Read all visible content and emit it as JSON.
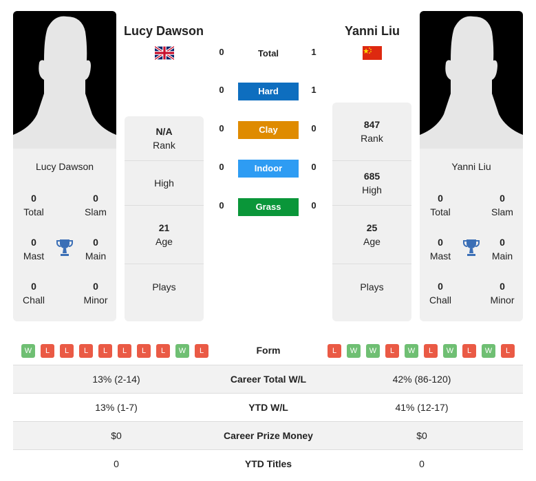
{
  "colors": {
    "hard": "#0e6ebf",
    "clay": "#df8b00",
    "indoor": "#2e9cf3",
    "grass": "#0a9639",
    "win": "#6fbf73",
    "loss": "#ea5a45",
    "trophy": "#3b6fb6"
  },
  "player1": {
    "name": "Lucy Dawson",
    "flag": "uk-flag",
    "rank": "N/A",
    "rank_label": "Rank",
    "high": "",
    "high_label": "High",
    "age": "21",
    "age_label": "Age",
    "plays": "",
    "plays_label": "Plays",
    "titles": {
      "total": "0",
      "total_label": "Total",
      "slam": "0",
      "slam_label": "Slam",
      "mast": "0",
      "mast_label": "Mast",
      "main": "0",
      "main_label": "Main",
      "chall": "0",
      "chall_label": "Chall",
      "minor": "0",
      "minor_label": "Minor"
    },
    "form": [
      "W",
      "L",
      "L",
      "L",
      "L",
      "L",
      "L",
      "L",
      "W",
      "L"
    ],
    "career_wl": "13% (2-14)",
    "ytd_wl": "13% (1-7)",
    "prize": "$0",
    "ytd_titles": "0"
  },
  "player2": {
    "name": "Yanni Liu",
    "flag": "china-flag",
    "rank": "847",
    "rank_label": "Rank",
    "high": "685",
    "high_label": "High",
    "age": "25",
    "age_label": "Age",
    "plays": "",
    "plays_label": "Plays",
    "titles": {
      "total": "0",
      "total_label": "Total",
      "slam": "0",
      "slam_label": "Slam",
      "mast": "0",
      "mast_label": "Mast",
      "main": "0",
      "main_label": "Main",
      "chall": "0",
      "chall_label": "Chall",
      "minor": "0",
      "minor_label": "Minor"
    },
    "form": [
      "L",
      "W",
      "W",
      "L",
      "W",
      "L",
      "W",
      "L",
      "W",
      "L"
    ],
    "career_wl": "42% (86-120)",
    "ytd_wl": "41% (12-17)",
    "prize": "$0",
    "ytd_titles": "0"
  },
  "h2h": {
    "total_label": "Total",
    "p1_total": "0",
    "p2_total": "1",
    "surfaces": [
      {
        "label": "Hard",
        "p1": "0",
        "p2": "1"
      },
      {
        "label": "Clay",
        "p1": "0",
        "p2": "0"
      },
      {
        "label": "Indoor",
        "p1": "0",
        "p2": "0"
      },
      {
        "label": "Grass",
        "p1": "0",
        "p2": "0"
      }
    ]
  },
  "table": {
    "form_label": "Form",
    "career_label": "Career Total W/L",
    "ytd_label": "YTD W/L",
    "prize_label": "Career Prize Money",
    "titles_label": "YTD Titles"
  }
}
